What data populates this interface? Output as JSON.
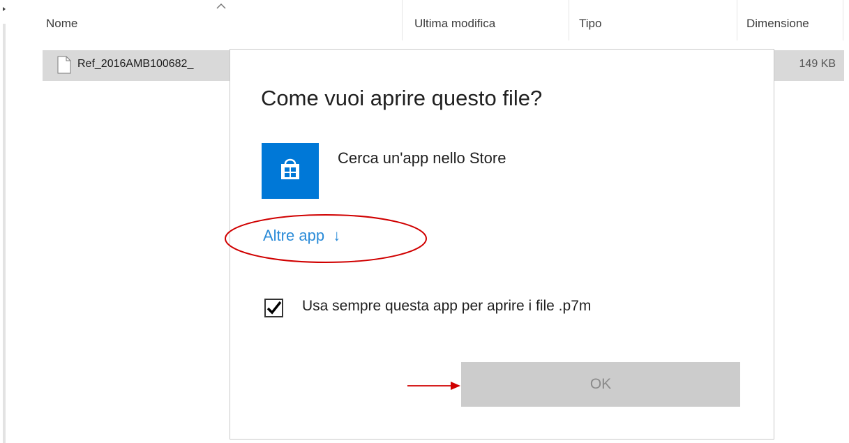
{
  "explorer": {
    "columns": {
      "name": "Nome",
      "modified": "Ultima modifica",
      "type": "Tipo",
      "size": "Dimensione"
    },
    "file": {
      "name": "Ref_2016AMB100682_",
      "size": "149 KB"
    }
  },
  "dialog": {
    "title": "Come vuoi aprire questo file?",
    "store_option": "Cerca un'app nello Store",
    "more_apps": "Altre app",
    "more_apps_arrow": "↓",
    "always_use_label": "Usa sempre questa app per aprire i file .p7m",
    "always_use_checked": true,
    "ok_label": "OK"
  },
  "annotations": {
    "ellipse_color": "#d00000",
    "arrow_color": "#d00000"
  },
  "icons": {
    "store": "store-bag-icon",
    "file": "file-icon",
    "sort": "chevron-up-icon",
    "check": "checkmark-icon"
  }
}
